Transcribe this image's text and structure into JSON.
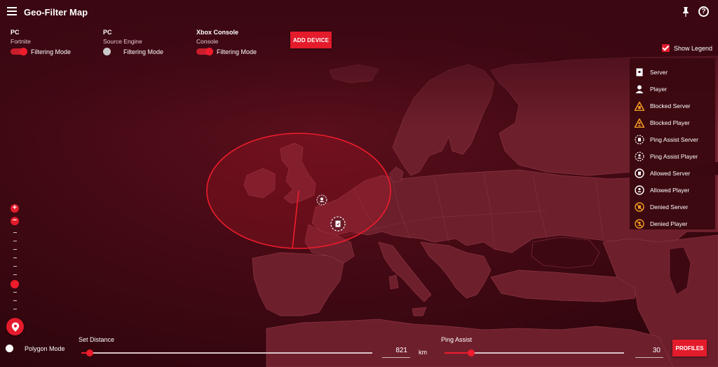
{
  "header": {
    "title": "Geo-Filter Map",
    "menu_icon": "hamburger-menu-icon",
    "pin_icon": "pin-icon",
    "help_label": "?"
  },
  "devices": [
    {
      "name": "PC",
      "sub": "Fortnite",
      "mode_label": "Filtering Mode",
      "filtering_on": true
    },
    {
      "name": "PC",
      "sub": "Source Engine",
      "mode_label": "Filtering Mode",
      "filtering_on": false
    },
    {
      "name": "Xbox Console",
      "sub": "Console",
      "mode_label": "Filtering Mode",
      "filtering_on": true
    }
  ],
  "add_device_label": "ADD DEVICE",
  "legend": {
    "toggle_label": "Show Legend",
    "checked": true,
    "items": [
      {
        "label": "Server",
        "icon": "server-icon"
      },
      {
        "label": "Player",
        "icon": "player-icon"
      },
      {
        "label": "Blocked Server",
        "icon": "blocked-server-icon"
      },
      {
        "label": "Blocked Player",
        "icon": "blocked-player-icon"
      },
      {
        "label": "Ping Assist Server",
        "icon": "ping-assist-server-icon"
      },
      {
        "label": "Ping Assist Player",
        "icon": "ping-assist-player-icon"
      },
      {
        "label": "Allowed Server",
        "icon": "allowed-server-icon"
      },
      {
        "label": "Allowed Player",
        "icon": "allowed-player-icon"
      },
      {
        "label": "Denied Server",
        "icon": "denied-server-icon"
      },
      {
        "label": "Denied Player",
        "icon": "denied-player-icon"
      }
    ]
  },
  "zoom": {
    "in_label": "+",
    "out_label": "−"
  },
  "polygon_mode_label": "Polygon Mode",
  "distance": {
    "label": "Set Distance",
    "value": "821",
    "unit": "km",
    "fraction": 0.03
  },
  "ping_assist": {
    "label": "Ping Assist",
    "value": "30",
    "fraction": 0.15
  },
  "profiles_label": "PROFILES",
  "colors": {
    "accent": "#e31b2b",
    "background": "#3c0712",
    "land": "#6c1e2b",
    "sea": "#420a14"
  }
}
